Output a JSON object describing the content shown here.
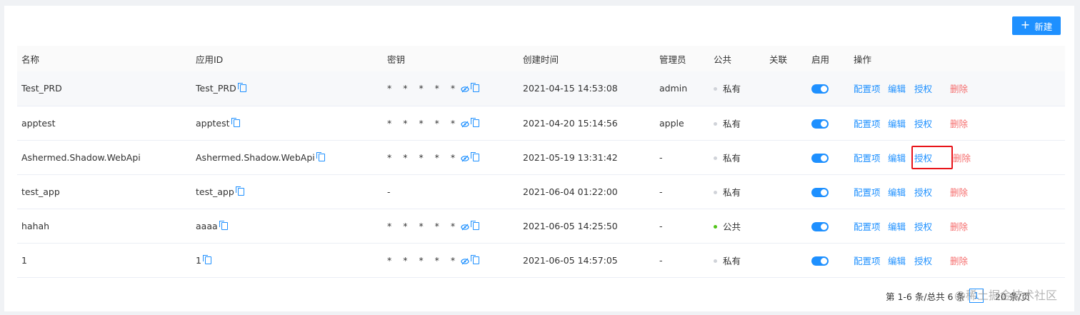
{
  "toolbar": {
    "new_label": "新建"
  },
  "table": {
    "columns": [
      "名称",
      "应用ID",
      "密钥",
      "创建时间",
      "管理员",
      "公共",
      "关联",
      "启用",
      "操作"
    ],
    "actions": {
      "config": "配置项",
      "edit": "编辑",
      "auth": "授权",
      "delete": "删除"
    },
    "rows": [
      {
        "name": "Test_PRD",
        "app_id": "Test_PRD",
        "secret": "* * * * *",
        "created": "2021-04-15 14:53:08",
        "admin": "admin",
        "public": "私有",
        "public_status": "private",
        "enabled": true
      },
      {
        "name": "apptest",
        "app_id": "apptest",
        "secret": "* * * * *",
        "created": "2021-04-20 15:14:56",
        "admin": "apple",
        "public": "私有",
        "public_status": "private",
        "enabled": true
      },
      {
        "name": "Ashermed.Shadow.WebApi",
        "app_id": "Ashermed.Shadow.WebApi",
        "secret": "* * * * *",
        "created": "2021-05-19 13:31:42",
        "admin": "-",
        "public": "私有",
        "public_status": "private",
        "enabled": true
      },
      {
        "name": "test_app",
        "app_id": "test_app",
        "secret": "-",
        "created": "2021-06-04 01:22:00",
        "admin": "-",
        "public": "私有",
        "public_status": "private",
        "enabled": true
      },
      {
        "name": "hahah",
        "app_id": "aaaa",
        "secret": "* * * * *",
        "created": "2021-06-05 14:25:50",
        "admin": "-",
        "public": "公共",
        "public_status": "public",
        "enabled": true
      },
      {
        "name": "1",
        "app_id": "1",
        "secret": "* * * * *",
        "created": "2021-06-05 14:57:05",
        "admin": "-",
        "public": "私有",
        "public_status": "private",
        "enabled": true
      }
    ]
  },
  "pagination": {
    "summary": "第 1-6 条/总共 6 条",
    "current_page": "1",
    "page_size": "20 条/页"
  },
  "watermark": "@稀土掘金技术社区",
  "colors": {
    "accent": "#1e90ff",
    "danger": "#f56c6c",
    "highlight": "#e8141a",
    "public_dot": "#52c41a"
  }
}
